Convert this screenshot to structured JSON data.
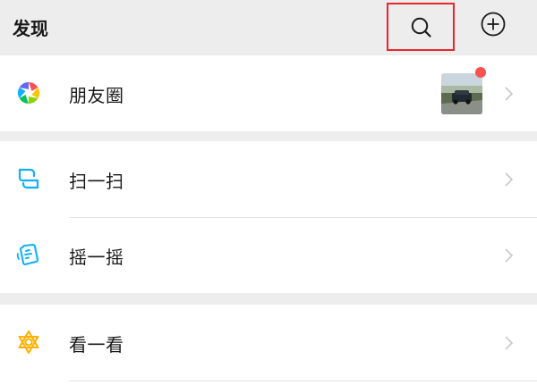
{
  "header": {
    "title": "发现"
  },
  "moments": {
    "label": "朋友圈"
  },
  "scan": {
    "label": "扫一扫"
  },
  "shake": {
    "label": "摇一摇"
  },
  "look": {
    "label": "看一看"
  },
  "colors": {
    "accent": "#e8262c",
    "badge": "#fa5151",
    "background": "#ededed"
  }
}
